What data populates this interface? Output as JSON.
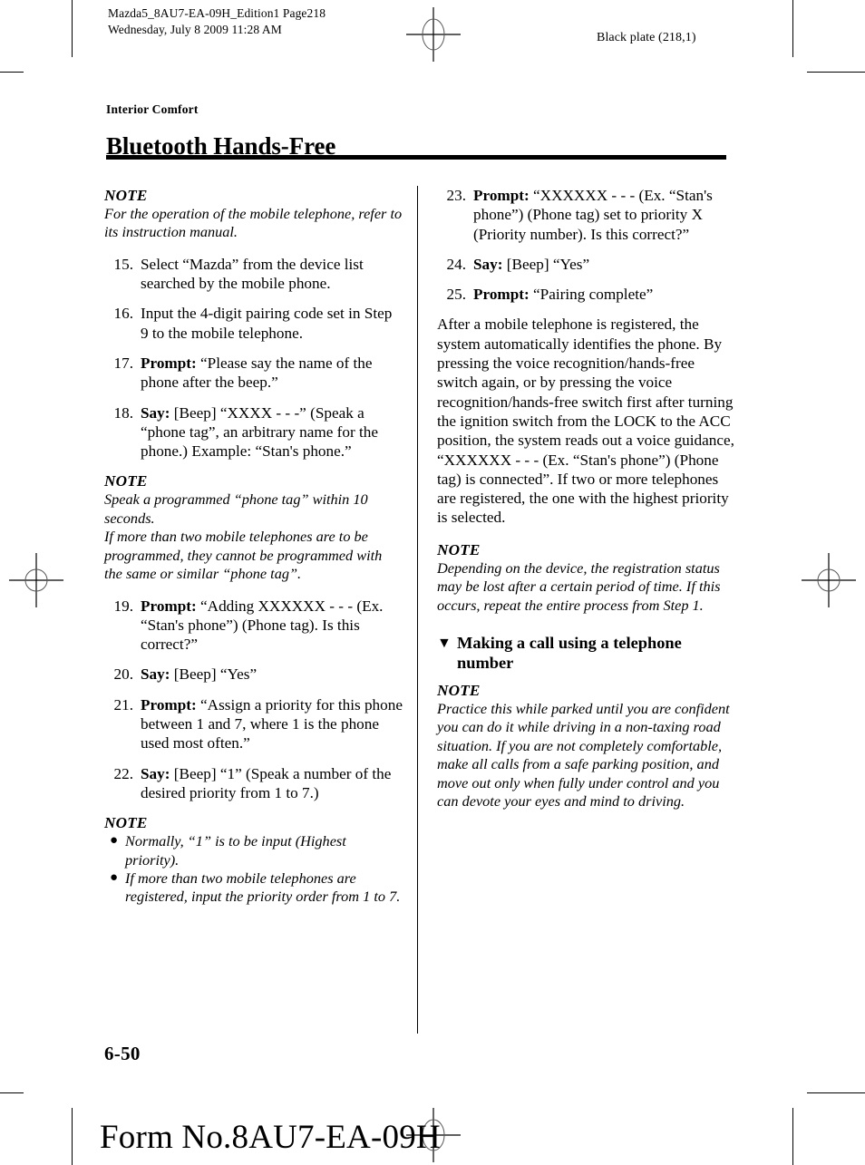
{
  "printer_marks": {
    "slug_left": "Mazda5_8AU7-EA-09H_Edition1 Page218\nWednesday, July 8 2009 11:28 AM",
    "slug_right": "Black plate (218,1)"
  },
  "header": {
    "chapter": "Interior Comfort",
    "title": "Bluetooth Hands-Free"
  },
  "left_column": {
    "note_1": {
      "head": "NOTE",
      "body": "For the operation of the mobile telephone, refer to its instruction manual."
    },
    "steps_a": [
      {
        "num": "15.",
        "lead": "",
        "text": "Select “Mazda” from the device list searched by the mobile phone."
      },
      {
        "num": "16.",
        "lead": "",
        "text": "Input the 4-digit pairing code set in Step 9 to the mobile telephone."
      },
      {
        "num": "17.",
        "lead": "Prompt:",
        "text": " “Please say the name of the phone after the beep.”"
      },
      {
        "num": "18.",
        "lead": "Say:",
        "text": " [Beep] “XXXX - - -” (Speak a “phone tag”, an arbitrary name for the phone.) Example: “Stan's phone.”"
      }
    ],
    "note_2": {
      "head": "NOTE",
      "body_1": "Speak a programmed “phone tag” within 10 seconds.",
      "body_2": "If more than two mobile telephones are to be programmed, they cannot be programmed with the same or similar “phone tag”."
    },
    "steps_b": [
      {
        "num": "19.",
        "lead": "Prompt:",
        "text": " “Adding XXXXXX - - - (Ex. “Stan's phone”) (Phone tag). Is this correct?”"
      },
      {
        "num": "20.",
        "lead": "Say:",
        "text": " [Beep] “Yes”"
      },
      {
        "num": "21.",
        "lead": "Prompt:",
        "text": " “Assign a priority for this phone between 1 and 7, where 1 is the phone used most often.”"
      },
      {
        "num": "22.",
        "lead": "Say:",
        "text": " [Beep] “1” (Speak a number of the desired priority from 1 to 7.)"
      }
    ],
    "note_3": {
      "head": "NOTE",
      "items": [
        "Normally, “1” is to be input (Highest priority).",
        "If more than two mobile telephones are registered, input the priority order from 1 to 7."
      ]
    }
  },
  "right_column": {
    "steps_c": [
      {
        "num": "23.",
        "lead": "Prompt:",
        "text": " “XXXXXX - - - (Ex. “Stan's phone”) (Phone tag) set to priority X (Priority number). Is this correct?”"
      },
      {
        "num": "24.",
        "lead": "Say:",
        "text": " [Beep] “Yes”"
      },
      {
        "num": "25.",
        "lead": "Prompt:",
        "text": " “Pairing complete”"
      }
    ],
    "paragraph": "After a mobile telephone is registered, the system automatically identifies the phone. By pressing the voice recognition/hands-free switch again, or by pressing the voice recognition/hands-free switch first after turning the ignition switch from the LOCK to the ACC position, the system reads out a voice guidance, “XXXXXX - - - (Ex. “Stan's phone”) (Phone tag) is connected”. If two or more telephones are registered, the one with the highest priority is selected.",
    "note_4": {
      "head": "NOTE",
      "body": "Depending on the device, the registration status may be lost after a certain period of time. If this occurs, repeat the entire process from Step 1."
    },
    "subheading": {
      "marker": "▼",
      "text": "Making a call using a telephone number"
    },
    "note_5": {
      "head": "NOTE",
      "body": "Practice this while parked until you are confident you can do it while driving in a non-taxing road situation. If you are not completely comfortable, make all calls from a safe parking position, and move out only when fully under control and you can devote your eyes and mind to driving."
    }
  },
  "footer": {
    "folio": "6-50",
    "form_number": "Form No.8AU7-EA-09H"
  }
}
